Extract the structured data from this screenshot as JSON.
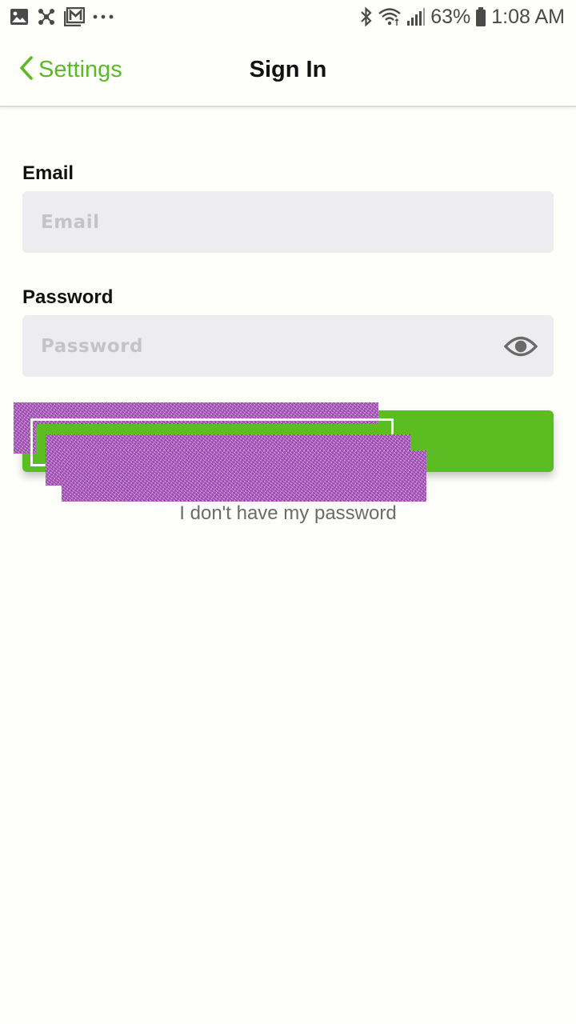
{
  "status_bar": {
    "battery": "63%",
    "time": "1:08 AM",
    "left_icons": [
      "image-icon",
      "network-icon",
      "mail-icon",
      "more-dots-icon"
    ],
    "right_icons": [
      "bluetooth-icon",
      "wifi-icon",
      "signal-icon",
      "battery-icon"
    ]
  },
  "nav": {
    "back_label": "Settings",
    "title": "Sign In"
  },
  "form": {
    "email": {
      "label": "Email",
      "placeholder": "Email",
      "value": ""
    },
    "password": {
      "label": "Password",
      "placeholder": "Password",
      "value": "",
      "toggle_icon": "eye-icon"
    }
  },
  "forgot_link": "I don't have my password",
  "colors": {
    "accent": "#5cba24",
    "button": "#5cbd22",
    "field_bg": "#ededef",
    "background": "#fefefb"
  }
}
